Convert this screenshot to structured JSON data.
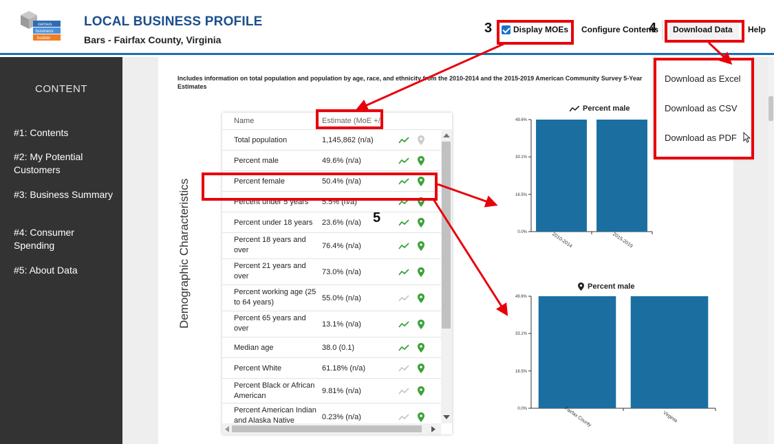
{
  "header": {
    "logo_words": [
      "census",
      "business",
      "builder"
    ],
    "title": "LOCAL BUSINESS PROFILE",
    "subtitle": "Bars - Fairfax County, Virginia",
    "display_moes_label": "Display MOEs",
    "display_moes_checked": true,
    "configure_label": "Configure Contents",
    "download_label": "Download Data",
    "help_label": "Help"
  },
  "annotations": {
    "n3": "3",
    "n4": "4",
    "n5": "5",
    "color": "#e8000b"
  },
  "sidebar": {
    "heading": "CONTENT",
    "items": [
      {
        "label": "#1: Contents"
      },
      {
        "label": "#2: My Potential Customers"
      },
      {
        "label": "#3: Business Summary"
      },
      {
        "label": "#4: Consumer Spending"
      },
      {
        "label": "#5: About Data"
      }
    ]
  },
  "main": {
    "intro": "Includes information on total population and population by age, race, and ethnicity from the 2010-2014 and the 2015-2019 American Community Survey 5-Year Estimates",
    "section_title": "Demographic Characteristics"
  },
  "table": {
    "headers": {
      "name": "Name",
      "estimate": "Estimate (MoE +/-)"
    },
    "rows": [
      {
        "name": "Total population",
        "estimate": "1,145,862 (n/a)",
        "trend_active": true,
        "map_active": false
      },
      {
        "name": "Percent male",
        "estimate": "49.6% (n/a)",
        "trend_active": true,
        "map_active": true
      },
      {
        "name": "Percent female",
        "estimate": "50.4% (n/a)",
        "trend_active": true,
        "map_active": true
      },
      {
        "name": "Percent under 5 years",
        "estimate": "5.5% (n/a)",
        "trend_active": true,
        "map_active": true
      },
      {
        "name": "Percent under 18 years",
        "estimate": "23.6% (n/a)",
        "trend_active": true,
        "map_active": true
      },
      {
        "name": "Percent 18 years and over",
        "estimate": "76.4% (n/a)",
        "trend_active": true,
        "map_active": true
      },
      {
        "name": "Percent 21 years and over",
        "estimate": "73.0% (n/a)",
        "trend_active": true,
        "map_active": true
      },
      {
        "name": "Percent working age (25 to 64 years)",
        "estimate": "55.0% (n/a)",
        "trend_active": false,
        "map_active": true
      },
      {
        "name": "Percent 65 years and over",
        "estimate": "13.1% (n/a)",
        "trend_active": true,
        "map_active": true
      },
      {
        "name": "Median age",
        "estimate": "38.0 (0.1)",
        "trend_active": true,
        "map_active": true
      },
      {
        "name": "Percent White",
        "estimate": "61.18% (n/a)",
        "trend_active": false,
        "map_active": true
      },
      {
        "name": "Percent Black or African American",
        "estimate": "9.81% (n/a)",
        "trend_active": false,
        "map_active": true
      },
      {
        "name": "Percent American Indian and Alaska Native",
        "estimate": "0.23% (n/a)",
        "trend_active": false,
        "map_active": true
      }
    ]
  },
  "dropdown": {
    "items": [
      "Download as Excel",
      "Download as CSV",
      "Download as PDF"
    ]
  },
  "colors": {
    "bar": "#1a6fa0",
    "trend_active": "#3aa33a",
    "trend_inactive": "#c8c8c8",
    "pin_active": "#3aa33a",
    "pin_inactive": "#cccccc"
  },
  "chart_data": [
    {
      "type": "bar",
      "title": "Percent male",
      "title_icon": "trend-icon",
      "categories": [
        "2010-2014",
        "2015-2019"
      ],
      "values": [
        49.6,
        49.6
      ],
      "yticks": [
        "0.0%",
        "16.5%",
        "33.1%",
        "49.6%"
      ],
      "ytick_values": [
        0,
        16.5,
        33.1,
        49.6
      ],
      "ylim": [
        0,
        49.6
      ]
    },
    {
      "type": "bar",
      "title": "Percent male",
      "title_icon": "map-pin-icon",
      "categories": [
        "Fairfax County",
        "Virginia"
      ],
      "values": [
        49.6,
        49.6
      ],
      "yticks": [
        "0.0%",
        "16.5%",
        "33.1%",
        "49.6%"
      ],
      "ytick_values": [
        0,
        16.5,
        33.1,
        49.6
      ],
      "ylim": [
        0,
        49.6
      ]
    }
  ]
}
